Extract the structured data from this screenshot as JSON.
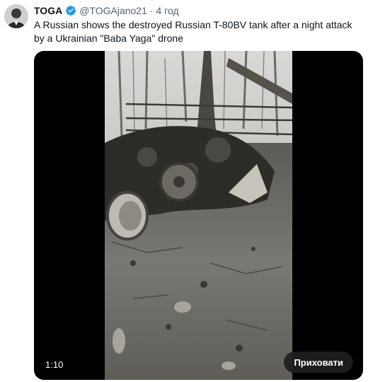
{
  "author": {
    "name": "TOGA",
    "handle": "@TOGAjano21",
    "separator": "·",
    "time": "4 год"
  },
  "tweet": {
    "text": "A Russian shows the destroyed Russian T-80BV tank after a night attack by a Ukrainian \"Baba Yaga\" drone"
  },
  "media": {
    "duration": "1:10",
    "hide_label": "Приховати"
  },
  "icons": {
    "verified": "verified-badge-icon"
  },
  "colors": {
    "verified_blue": "#1d9bf0",
    "secondary_text": "#536471",
    "primary_text": "#0f1419",
    "media_background": "#000000"
  }
}
